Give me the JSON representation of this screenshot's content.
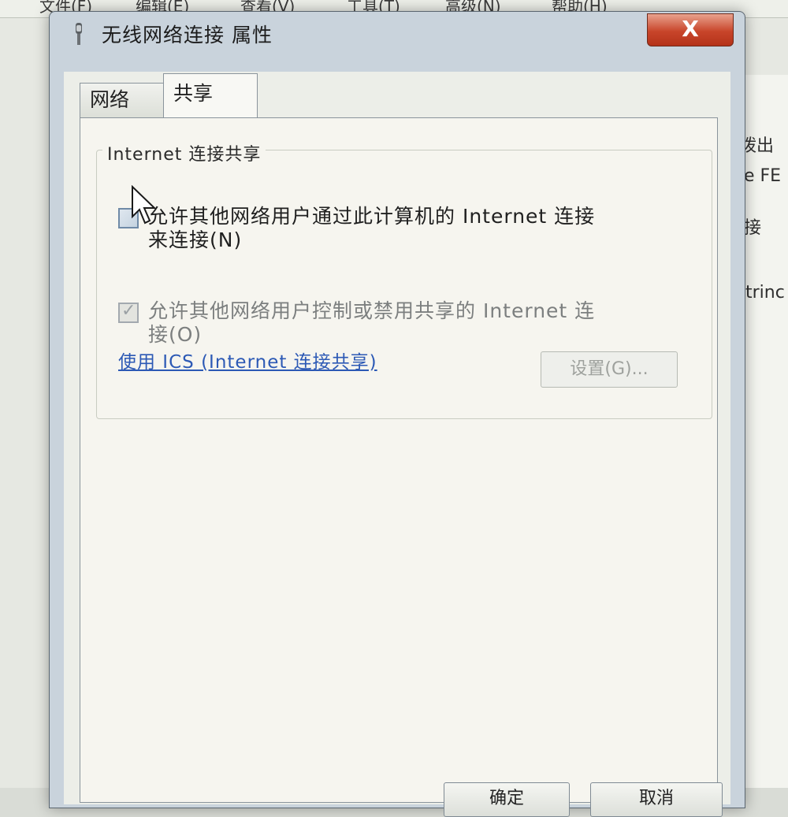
{
  "background": {
    "menu": [
      "文件(F)",
      "编辑(E)",
      "查看(V)",
      "工具(T)",
      "高级(N)",
      "帮助(H)"
    ],
    "right_snippets": [
      "拨出",
      "e FE",
      "接",
      "trinc"
    ]
  },
  "dialog": {
    "title": "无线网络连接 属性",
    "close_label": "X",
    "tabs": [
      {
        "label": "网络",
        "active": false
      },
      {
        "label": "共享",
        "active": true
      }
    ],
    "group": {
      "legend": "Internet 连接共享",
      "allow_share": {
        "checked": false,
        "label_line1": "允许其他网络用户通过此计算机的 Internet 连接",
        "label_line2": "来连接(N)"
      },
      "allow_control": {
        "checked": true,
        "disabled": true,
        "label_line1": "允许其他网络用户控制或禁用共享的 Internet 连",
        "label_line2": "接(O)"
      },
      "ics_link": "使用 ICS (Internet 连接共享)",
      "settings_button": "设置(G)..."
    },
    "buttons": {
      "ok": "确定",
      "cancel": "取消"
    }
  },
  "colors": {
    "link": "#2c59b5",
    "close_button": "#c8452a"
  }
}
